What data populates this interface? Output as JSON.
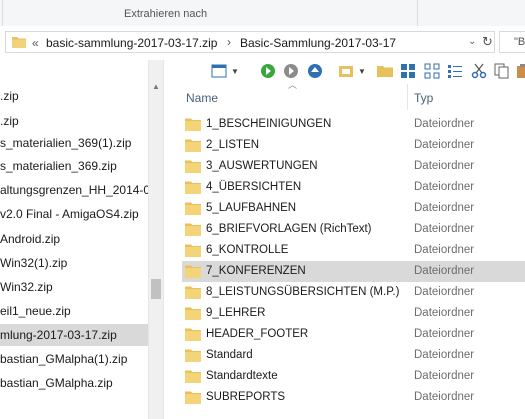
{
  "ribbon": {
    "label": "Extrahieren nach"
  },
  "address": {
    "crumbs": [
      "basic-sammlung-2017-03-17.zip",
      "Basic-Sammlung-2017-03-17"
    ],
    "overflow": "«",
    "separator": "›",
    "dropdown": "⌄",
    "refresh": "↻"
  },
  "search": {
    "text": "\"B"
  },
  "nav": {
    "items": [
      {
        "label": ".zip",
        "selected": false
      },
      {
        "label": ".zip",
        "selected": false
      },
      {
        "label": "s_materialien_369(1).zip",
        "selected": false
      },
      {
        "label": "s_materialien_369.zip",
        "selected": false
      },
      {
        "label": "altungsgrenzen_HH_2014-09",
        "selected": false
      },
      {
        "label": "v2.0 Final - AmigaOS4.zip",
        "selected": false
      },
      {
        "label": "Android.zip",
        "selected": false
      },
      {
        "label": "Win32(1).zip",
        "selected": false
      },
      {
        "label": "Win32.zip",
        "selected": false
      },
      {
        "label": "eil1_neue.zip",
        "selected": false
      },
      {
        "label": "mlung-2017-03-17.zip",
        "selected": true
      },
      {
        "label": "bastian_GMalpha(1).zip",
        "selected": false
      },
      {
        "label": "bastian_GMalpha.zip",
        "selected": false
      }
    ]
  },
  "list": {
    "columns": {
      "name": "Name",
      "type": "Typ"
    },
    "rows": [
      {
        "name": "1_BESCHEINIGUNGEN",
        "type": "Dateiordner",
        "highlighted": false
      },
      {
        "name": "2_LISTEN",
        "type": "Dateiordner",
        "highlighted": false
      },
      {
        "name": "3_AUSWERTUNGEN",
        "type": "Dateiordner",
        "highlighted": false
      },
      {
        "name": "4_ÜBERSICHTEN",
        "type": "Dateiordner",
        "highlighted": false
      },
      {
        "name": "5_LAUFBAHNEN",
        "type": "Dateiordner",
        "highlighted": false
      },
      {
        "name": "6_BRIEFVORLAGEN (RichText)",
        "type": "Dateiordner",
        "highlighted": false
      },
      {
        "name": "6_KONTROLLE",
        "type": "Dateiordner",
        "highlighted": false
      },
      {
        "name": "7_KONFERENZEN",
        "type": "Dateiordner",
        "highlighted": true
      },
      {
        "name": "8_LEISTUNGSÜBERSICHTEN (M.P.)",
        "type": "Dateiordner",
        "highlighted": false
      },
      {
        "name": "9_LEHRER",
        "type": "Dateiordner",
        "highlighted": false
      },
      {
        "name": "HEADER_FOOTER",
        "type": "Dateiordner",
        "highlighted": false
      },
      {
        "name": "Standard",
        "type": "Dateiordner",
        "highlighted": false
      },
      {
        "name": "Standardtexte",
        "type": "Dateiordner",
        "highlighted": false
      },
      {
        "name": "SUBREPORTS",
        "type": "Dateiordner",
        "highlighted": false
      }
    ]
  },
  "colors": {
    "folder": "#e8c15a",
    "selection": "#d9d9d9",
    "header_text": "#4c607a",
    "type_text": "#6d6d6d"
  }
}
